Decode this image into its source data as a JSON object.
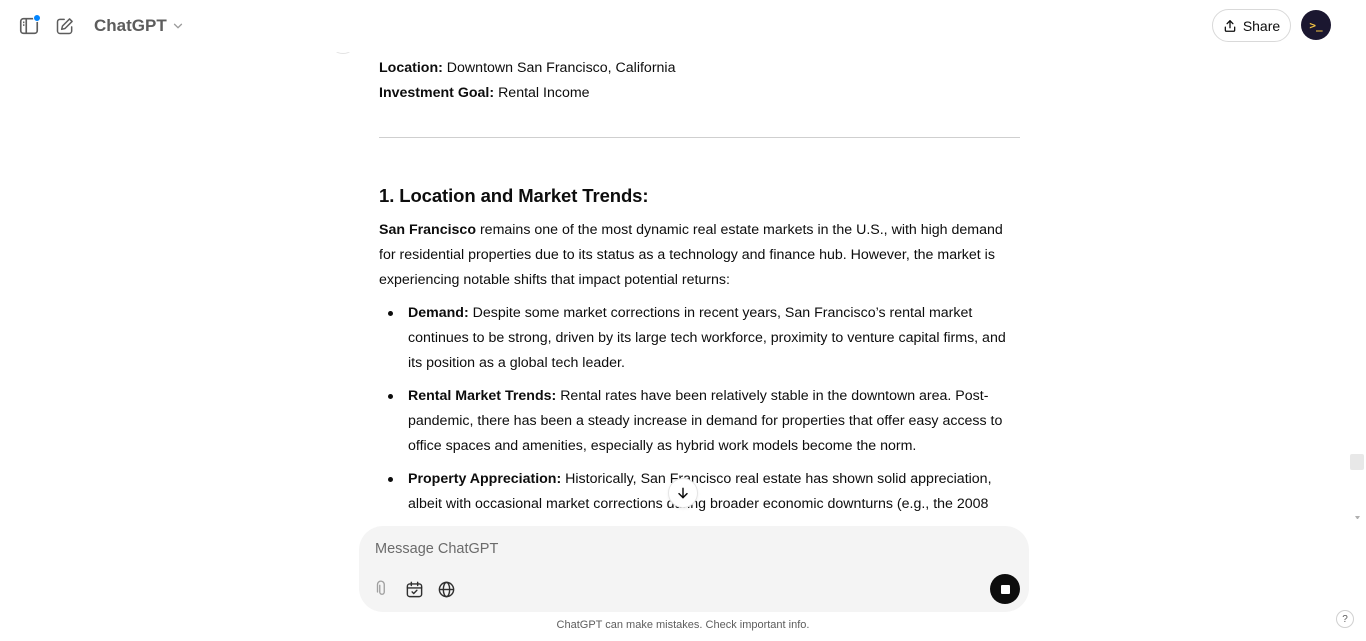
{
  "header": {
    "model_name": "ChatGPT",
    "share_label": "Share",
    "avatar_glyph": ">_"
  },
  "article": {
    "meta": [
      {
        "label": "Location:",
        "value": "Downtown San Francisco, California"
      },
      {
        "label": "Investment Goal:",
        "value": "Rental Income"
      }
    ],
    "section_heading": "1. Location and Market Trends:",
    "intro_bold": "San Francisco",
    "intro_text": "remains one of the most dynamic real estate markets in the U.S., with high demand for residential properties due to its status as a technology and finance hub. However, the market is experiencing notable shifts that impact potential returns:",
    "bullets": [
      {
        "label": "Demand:",
        "text": "Despite some market corrections in recent years, San Francisco’s rental market continues to be strong, driven by its large tech workforce, proximity to venture capital firms, and its position as a global tech leader."
      },
      {
        "label": "Rental Market Trends:",
        "text": "Rental rates have been relatively stable in the downtown area. Post-pandemic, there has been a steady increase in demand for properties that offer easy access to office spaces and amenities, especially as hybrid work models become the norm."
      },
      {
        "label": "Property Appreciation:",
        "text": "Historically, San Francisco real estate has shown solid appreciation, albeit with occasional market corrections during broader economic downturns (e.g., the 2008"
      }
    ]
  },
  "composer": {
    "placeholder": "Message ChatGPT"
  },
  "footer": {
    "disclaimer": "ChatGPT can make mistakes. Check important info.",
    "help_label": "?"
  },
  "colors": {
    "accent_dot": "#0285ff",
    "stop_button": "#0d0d0d",
    "composer_bg": "#f4f4f4"
  },
  "icons": [
    "sidebar-toggle-icon",
    "new-chat-icon",
    "chevron-down-icon",
    "share-icon",
    "arrow-down-icon",
    "paperclip-icon",
    "canvas-icon",
    "globe-icon",
    "stop-icon"
  ]
}
